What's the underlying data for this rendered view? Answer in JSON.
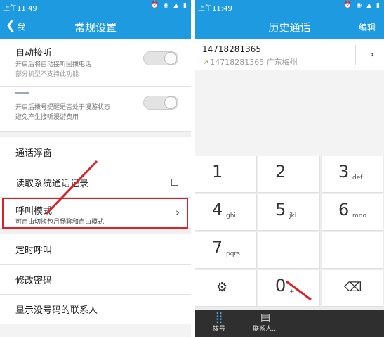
{
  "left_screen": {
    "status_time": "上午11:49",
    "status_icons": "⏰ ◉ ▲ ▮",
    "back_label": "我",
    "title": "常规设置",
    "auto_answer": {
      "title": "自动接听",
      "subtitle1": "开启后将自动接听回拨电话",
      "subtitle2": "部分机型不支持此功能",
      "enabled": false
    },
    "roaming": {
      "subtitle1": "开启后拨号提醒是否处于漫游状态",
      "subtitle2": "避免产生接听漫游费用",
      "enabled": false
    },
    "float_window": "通话浮窗",
    "read_records": "读取系统通话记录",
    "call_mode": {
      "title": "呼叫模式",
      "subtitle": "可自由切换包月畅聊和自由模式"
    },
    "timed_call": "定时呼叫",
    "change_password": "修改密码",
    "show_no_number": "显示没号码的联系人"
  },
  "right_screen": {
    "status_time": "上午11:49",
    "status_icons": "⏰ ◉ ▲ ▮",
    "title": "历史通话",
    "edit": "编辑",
    "call": {
      "number": "14718281365",
      "detail": "14718281365 广东梅州"
    },
    "keys": [
      {
        "digit": "1",
        "letters": ""
      },
      {
        "digit": "2",
        "letters": ""
      },
      {
        "digit": "3",
        "letters": "def"
      },
      {
        "digit": "4",
        "letters": "ghi"
      },
      {
        "digit": "5",
        "letters": "jkl"
      },
      {
        "digit": "6",
        "letters": "mno"
      },
      {
        "digit": "7",
        "letters": "pqrs"
      },
      {
        "digit": "0",
        "letters": "+"
      }
    ],
    "tabs": {
      "dial": "拨号",
      "contacts": "联系人..."
    }
  },
  "colors": {
    "accent": "#1e9ae0",
    "highlight": "#d9232a",
    "dark_bar": "#2f2f2f"
  }
}
